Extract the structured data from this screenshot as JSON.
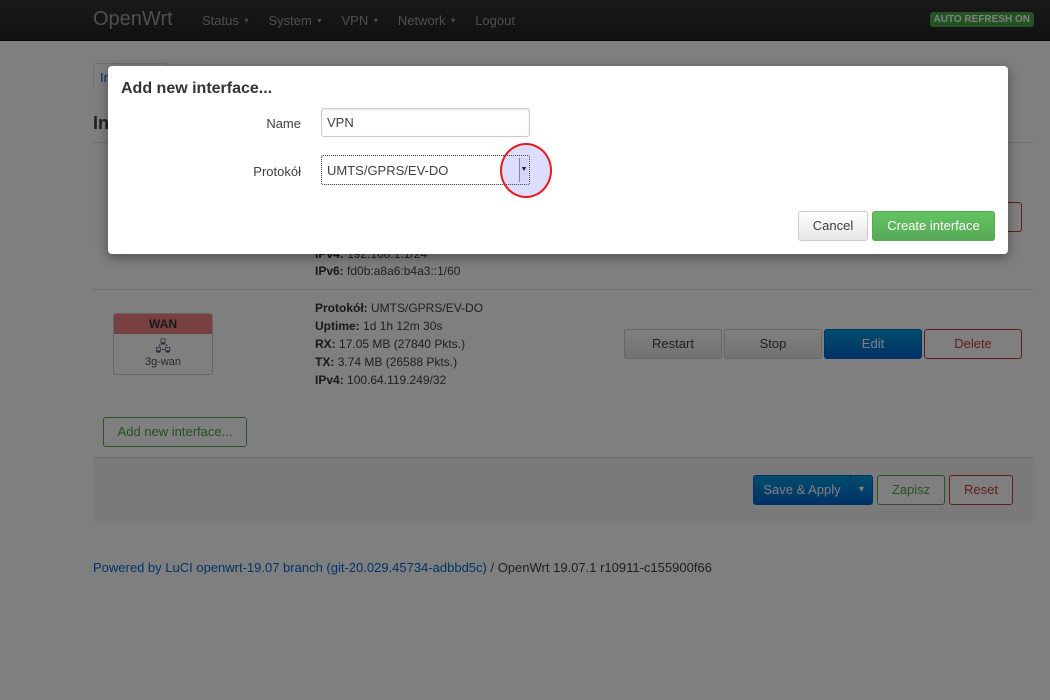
{
  "topbar": {
    "brand": "OpenWrt",
    "menu": [
      {
        "label": "Status",
        "has_caret": true
      },
      {
        "label": "System",
        "has_caret": true
      },
      {
        "label": "VPN",
        "has_caret": true
      },
      {
        "label": "Network",
        "has_caret": true
      },
      {
        "label": "Logout",
        "has_caret": false
      }
    ],
    "caret_glyph": "▾",
    "auto_refresh": "AUTO REFRESH ON"
  },
  "page": {
    "tab_partial": "In",
    "heading_partial": "In",
    "lan_partial": {
      "ipv4": {
        "label": "IPv4:",
        "value": "192.168.1.1/24"
      },
      "ipv6": {
        "label": "IPv6:",
        "value": "fd0b:a8a6:b4a3::1/60"
      }
    },
    "wan": {
      "zone": "WAN",
      "icon": "network-interface-icon",
      "icon_glyph": "🖧",
      "name": "3g-wan",
      "info": [
        {
          "label": "Protokół:",
          "value": "UMTS/GPRS/EV-DO"
        },
        {
          "label": "Uptime:",
          "value": "1d 1h 12m 30s"
        },
        {
          "label": "RX:",
          "value": "17.05 MB (27840 Pkts.)"
        },
        {
          "label": "TX:",
          "value": "3.74 MB (26588 Pkts.)"
        },
        {
          "label": "IPv4:",
          "value": "100.64.119.249/32"
        }
      ],
      "buttons": {
        "restart": "Restart",
        "stop": "Stop",
        "edit": "Edit",
        "delete": "Delete"
      }
    },
    "add_interface": "Add new interface...",
    "actions": {
      "save_apply": "Save & Apply",
      "dropdown_glyph": "▾",
      "save": "Zapisz",
      "reset": "Reset"
    },
    "footer": {
      "link_text": "Powered by LuCI openwrt-19.07 branch (git-20.029.45734-adbbd5c)",
      "separator": " / ",
      "version": "OpenWrt 19.07.1 r10911-c155900f66"
    }
  },
  "modal": {
    "title": "Add new interface...",
    "name_label": "Name",
    "name_value": "VPN",
    "protocol_label": "Protokół",
    "protocol_value": "UMTS/GPRS/EV-DO",
    "arrow_glyph": "▼",
    "cancel": "Cancel",
    "create": "Create interface"
  },
  "colors": {
    "highlight_circle": "#e21b1b",
    "create_button": "#57a957",
    "edit_button": "#0064cd",
    "wan_zone": "#f08080"
  }
}
